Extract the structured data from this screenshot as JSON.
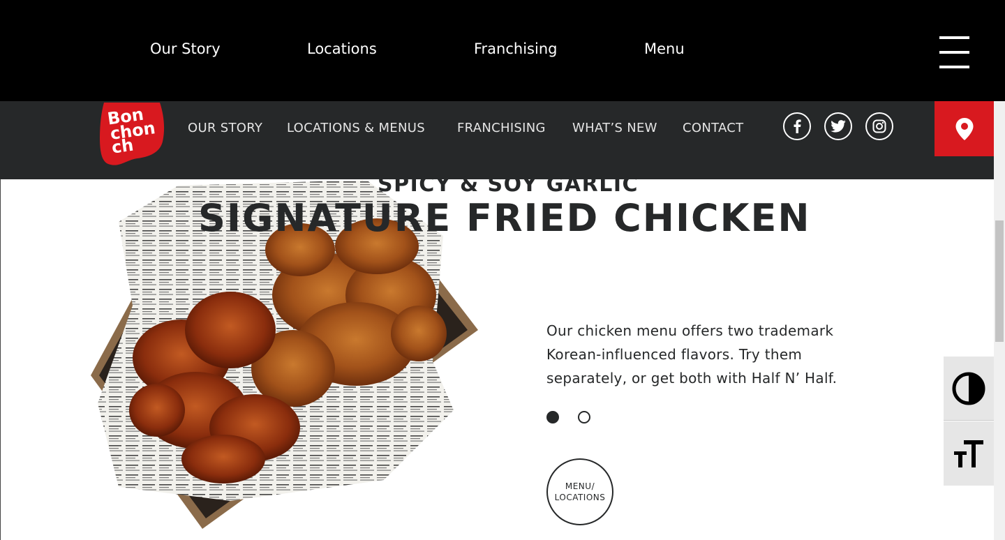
{
  "top_bar": {
    "links": [
      "Our Story",
      "Locations",
      "Franchising",
      "Menu"
    ]
  },
  "main_nav": {
    "logo_text": "Bonchon",
    "links": [
      "OUR STORY",
      "LOCATIONS & MENUS",
      "FRANCHISING",
      "WHAT’S NEW",
      "CONTACT"
    ],
    "social_icons": [
      "facebook-icon",
      "twitter-icon",
      "instagram-icon"
    ],
    "location_icon": "map-pin-icon"
  },
  "hero": {
    "subtitle": "SPICY & SOY GARLIC",
    "title": "SIGNATURE FRIED CHICKEN",
    "description": "Our chicken menu offers two trademark Korean-influenced flavors. Try them separately, or get both with Half N’ Half.",
    "carousel": {
      "total": 2,
      "active": 1
    },
    "cta_line1": "MENU/",
    "cta_line2": "LOCATIONS"
  },
  "accessibility": {
    "contrast_icon": "contrast-icon",
    "text_size_icon": "text-size-icon"
  },
  "colors": {
    "brand_red": "#d8191f",
    "nav_bg": "#262829",
    "top_bg": "#000000"
  }
}
